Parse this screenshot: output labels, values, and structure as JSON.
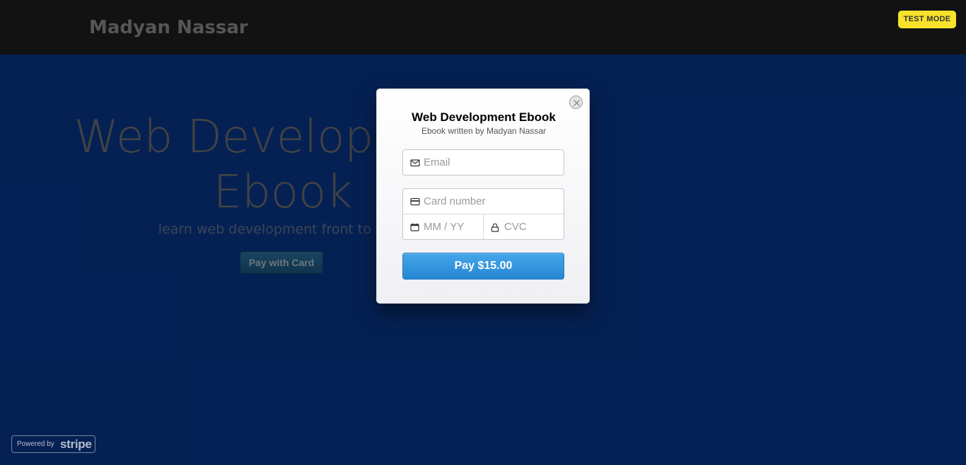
{
  "site": {
    "brand": "Madyan Nassar",
    "hero_title_line1": "Web Development",
    "hero_title_line2": "Ebook",
    "hero_subtitle": "learn web development front to back",
    "pay_with_card_label": "Pay with Card"
  },
  "badges": {
    "test_mode": "TEST MODE",
    "powered_by": "Powered by",
    "powered_brand": "stripe"
  },
  "checkout": {
    "title": "Web Development Ebook",
    "subtitle": "Ebook written by Madyan Nassar",
    "email_placeholder": "Email",
    "card_number_placeholder": "Card number",
    "expiry_placeholder": "MM / YY",
    "cvc_placeholder": "CVC",
    "pay_label": "Pay $15.00"
  },
  "colors": {
    "accent": "#3a9be4",
    "test_mode": "#f7e22b",
    "hero_bg": "#0a3d9a"
  },
  "icons": [
    "close-icon",
    "mail-icon",
    "credit-card-icon",
    "calendar-icon",
    "lock-icon"
  ]
}
